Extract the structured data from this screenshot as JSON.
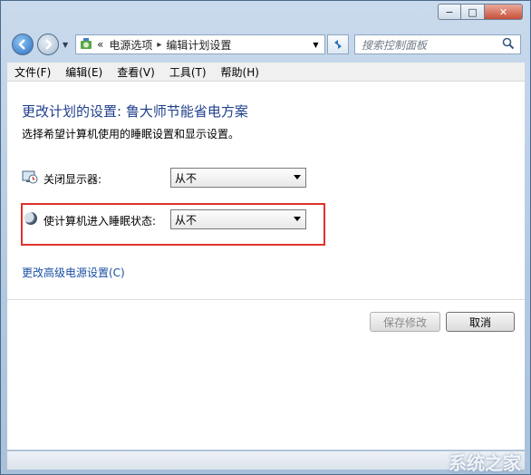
{
  "window": {
    "caption_buttons": [
      "−",
      "□",
      "✕"
    ]
  },
  "address": {
    "separator": "«",
    "crumbs": [
      "电源选项",
      "编辑计划设置"
    ],
    "crumb_arrow": "▸"
  },
  "search": {
    "placeholder": "搜索控制面板"
  },
  "menu": [
    {
      "label": "文件(F)"
    },
    {
      "label": "编辑(E)"
    },
    {
      "label": "查看(V)"
    },
    {
      "label": "工具(T)"
    },
    {
      "label": "帮助(H)"
    }
  ],
  "content": {
    "title": "更改计划的设置: 鲁大师节能省电方案",
    "description": "选择希望计算机使用的睡眠设置和显示设置。",
    "display_off": {
      "label": "关闭显示器:",
      "value": "从不",
      "icon": "monitor-clock-icon"
    },
    "sleep": {
      "label": "使计算机进入睡眠状态:",
      "value": "从不",
      "icon": "moon-icon"
    },
    "advanced_link": "更改高级电源设置(C)",
    "save_button": "保存修改",
    "cancel_button": "取消"
  },
  "watermark": "系统之家",
  "colors": {
    "title_blue": "#1f3f8c",
    "link_blue": "#1a4fa3",
    "highlight_red": "#e0332d"
  }
}
